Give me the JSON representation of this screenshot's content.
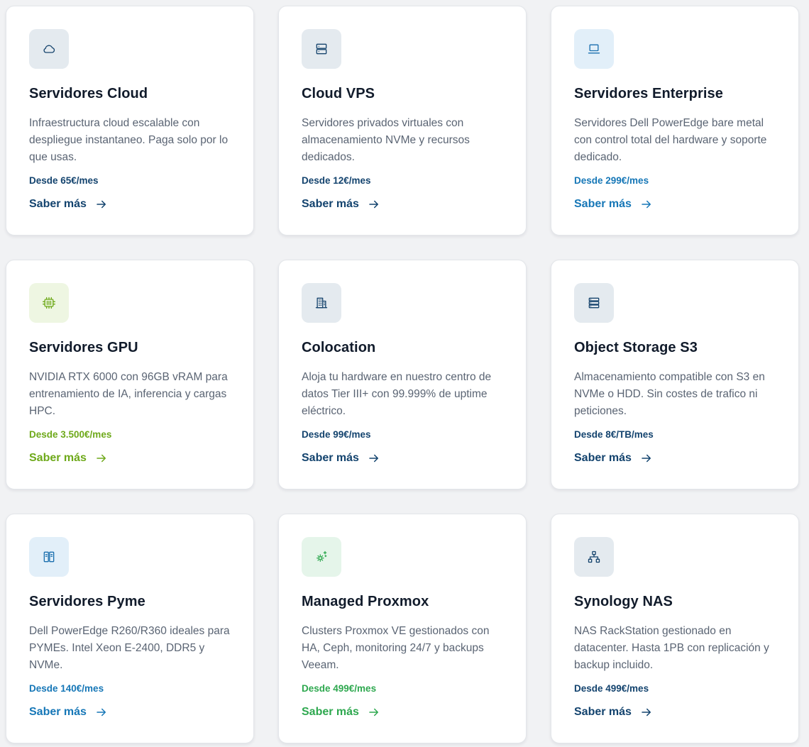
{
  "cards": [
    {
      "title": "Servidores Cloud",
      "description": "Infraestructura cloud escalable con despliegue instantaneo. Paga solo por lo que usas.",
      "price": "Desde 65€/mes",
      "link_label": "Saber más",
      "icon": "cloud-icon",
      "theme": "navy"
    },
    {
      "title": "Cloud VPS",
      "description": "Servidores privados virtuales con almacenamiento NVMe y recursos dedicados.",
      "price": "Desde 12€/mes",
      "link_label": "Saber más",
      "icon": "server-icon",
      "theme": "navy"
    },
    {
      "title": "Servidores Enterprise",
      "description": "Servidores Dell PowerEdge bare metal con control total del hardware y soporte dedicado.",
      "price": "Desde 299€/mes",
      "link_label": "Saber más",
      "icon": "laptop-icon",
      "theme": "blue"
    },
    {
      "title": "Servidores GPU",
      "description": "NVIDIA RTX 6000 con 96GB vRAM para entrenamiento de IA, inferencia y cargas HPC.",
      "price": "Desde 3.500€/mes",
      "link_label": "Saber más",
      "icon": "gpu-chip-icon",
      "theme": "lime"
    },
    {
      "title": "Colocation",
      "description": "Aloja tu hardware en nuestro centro de datos Tier III+ con 99.999% de uptime eléctrico.",
      "price": "Desde 99€/mes",
      "link_label": "Saber más",
      "icon": "building-icon",
      "theme": "navy"
    },
    {
      "title": "Object Storage S3",
      "description": "Almacenamiento compatible con S3 en NVMe o HDD. Sin costes de trafico ni peticiones.",
      "price": "Desde 8€/TB/mes",
      "link_label": "Saber más",
      "icon": "storage-stack-icon",
      "theme": "navy"
    },
    {
      "title": "Servidores Pyme",
      "description": "Dell PowerEdge R260/R360 ideales para PYMEs. Intel Xeon E-2400, DDR5 y NVMe.",
      "price": "Desde 140€/mes",
      "link_label": "Saber más",
      "icon": "server-columns-icon",
      "theme": "blue"
    },
    {
      "title": "Managed Proxmox",
      "description": "Clusters Proxmox VE gestionados con HA, Ceph, monitoring 24/7 y backups Veeam.",
      "price": "Desde 499€/mes",
      "link_label": "Saber más",
      "icon": "gear-sparkle-icon",
      "theme": "green"
    },
    {
      "title": "Synology NAS",
      "description": "NAS RackStation gestionado en datacenter. Hasta 1PB con replicación y backup incluido.",
      "price": "Desde 499€/mes",
      "link_label": "Saber más",
      "icon": "network-icon",
      "theme": "navy"
    }
  ],
  "theme_colors": {
    "navy": "#13436e",
    "blue": "#1677b7",
    "lime": "#6ea91a",
    "green": "#2ea84f"
  }
}
